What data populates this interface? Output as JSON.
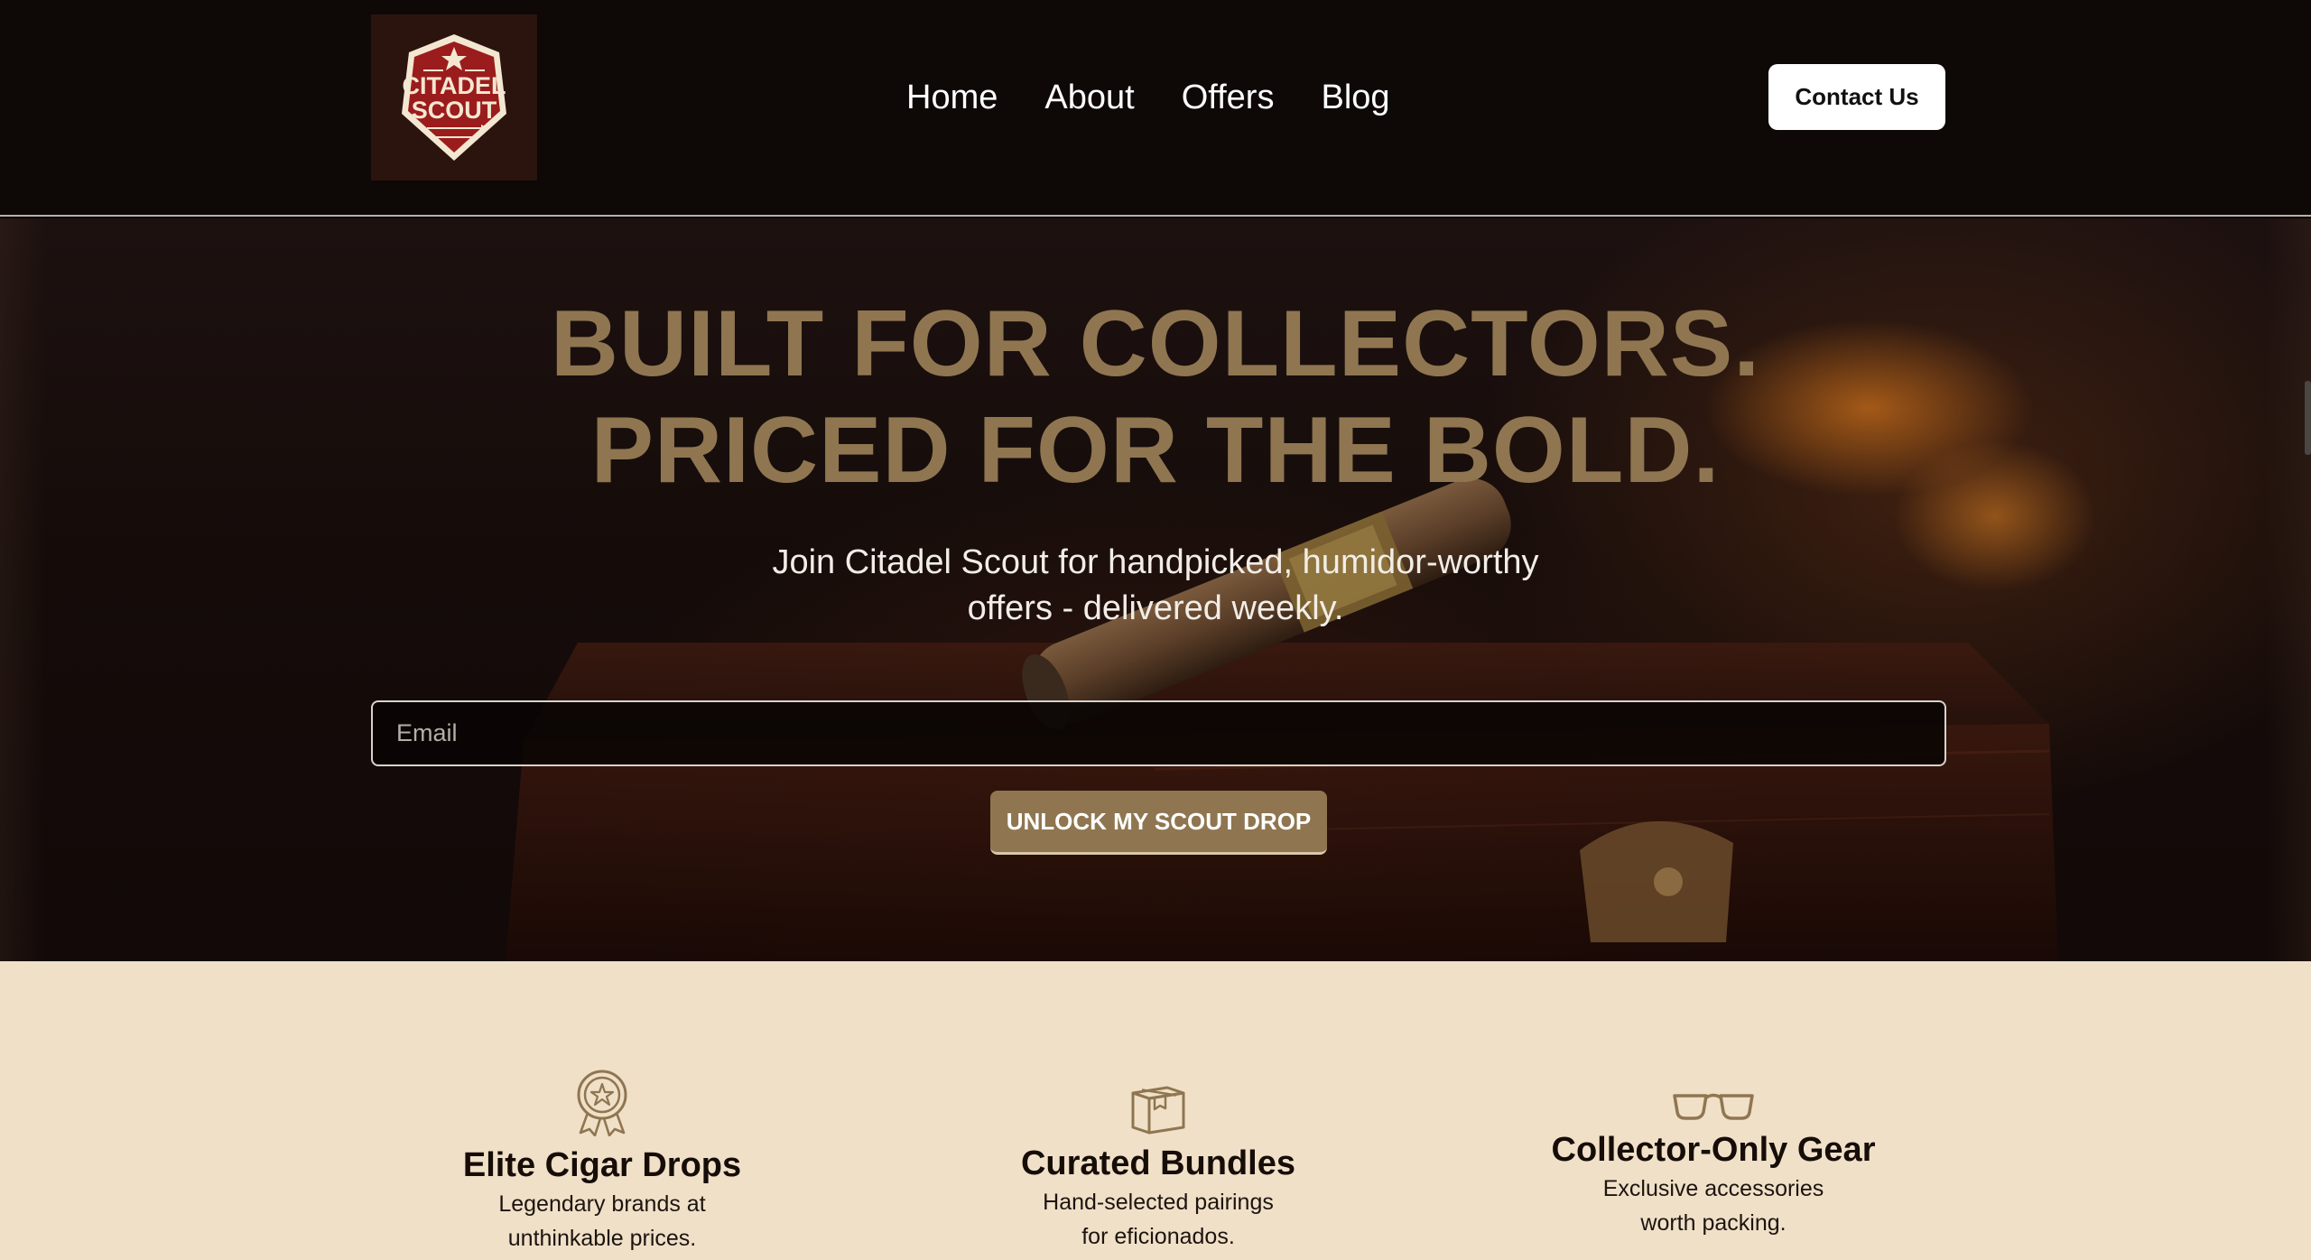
{
  "brand": {
    "logo_line1": "CITADEL",
    "logo_line2": "SCOUT",
    "logo_icon": "shield-badge-icon"
  },
  "nav": {
    "items": [
      {
        "label": "Home"
      },
      {
        "label": "About"
      },
      {
        "label": "Offers"
      },
      {
        "label": "Blog"
      }
    ],
    "contact_label": "Contact Us"
  },
  "hero": {
    "title_line1": "BUILT FOR COLLECTORS.",
    "title_line2": "PRICED FOR THE BOLD.",
    "subtitle_line1": "Join Citadel Scout for handpicked, humidor-worthy",
    "subtitle_line2": "offers - delivered weekly.",
    "email_placeholder": "Email",
    "email_value": "",
    "cta_label": "UNLOCK MY SCOUT DROP"
  },
  "features": [
    {
      "icon": "award-ribbon-icon",
      "title": "Elite Cigar Drops",
      "desc_line1": "Legendary brands at",
      "desc_line2": "unthinkable prices."
    },
    {
      "icon": "box-icon",
      "title": "Curated Bundles",
      "desc_line1": "Hand-selected pairings",
      "desc_line2": "for eficionados."
    },
    {
      "icon": "glasses-icon",
      "title": "Collector-Only Gear",
      "desc_line1": "Exclusive accessories",
      "desc_line2": "worth packing."
    }
  ],
  "colors": {
    "accent_gold": "#8f7651",
    "header_bg": "#0e0807",
    "features_bg": "#f0e0c8",
    "logo_red": "#9b1c1c"
  }
}
